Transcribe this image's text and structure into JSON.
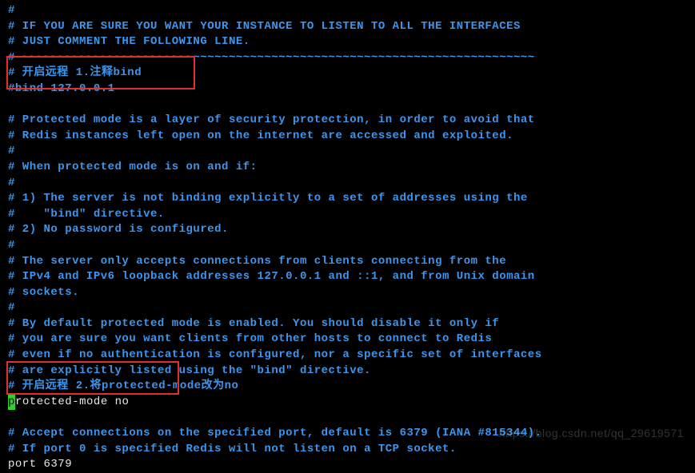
{
  "lines": [
    {
      "cls": "line",
      "text": "#"
    },
    {
      "cls": "line",
      "text": "# IF YOU ARE SURE YOU WANT YOUR INSTANCE TO LISTEN TO ALL THE INTERFACES"
    },
    {
      "cls": "line",
      "text": "# JUST COMMENT THE FOLLOWING LINE."
    },
    {
      "cls": "line",
      "text": "# ~~~~~~~~~~~~~~~~~~~~~~~~~~~~~~~~~~~~~~~~~~~~~~~~~~~~~~~~~~~~~~~~~~~~~~~~"
    },
    {
      "cls": "line",
      "text": "# 开启远程 1.注释bind"
    },
    {
      "cls": "line",
      "text": "#bind 127.0.0.1"
    },
    {
      "cls": "line",
      "text": ""
    },
    {
      "cls": "line",
      "text": "# Protected mode is a layer of security protection, in order to avoid that"
    },
    {
      "cls": "line",
      "text": "# Redis instances left open on the internet are accessed and exploited."
    },
    {
      "cls": "line",
      "text": "#"
    },
    {
      "cls": "line",
      "text": "# When protected mode is on and if:"
    },
    {
      "cls": "line",
      "text": "#"
    },
    {
      "cls": "line",
      "text": "# 1) The server is not binding explicitly to a set of addresses using the"
    },
    {
      "cls": "line",
      "text": "#    \"bind\" directive."
    },
    {
      "cls": "line",
      "text": "# 2) No password is configured."
    },
    {
      "cls": "line",
      "text": "#"
    },
    {
      "cls": "line",
      "text": "# The server only accepts connections from clients connecting from the"
    },
    {
      "cls": "line",
      "text": "# IPv4 and IPv6 loopback addresses 127.0.0.1 and ::1, and from Unix domain"
    },
    {
      "cls": "line",
      "text": "# sockets."
    },
    {
      "cls": "line",
      "text": "#"
    },
    {
      "cls": "line",
      "text": "# By default protected mode is enabled. You should disable it only if"
    },
    {
      "cls": "line",
      "text": "# you are sure you want clients from other hosts to connect to Redis"
    },
    {
      "cls": "line",
      "text": "# even if no authentication is configured, nor a specific set of interfaces"
    },
    {
      "cls": "line",
      "text": "# are explicitly listed using the \"bind\" directive."
    },
    {
      "cls": "line",
      "text": "# 开启远程 2.将protected-mode改为no"
    },
    {
      "cls": "white-line",
      "cursor": true,
      "text": "rotected-mode no"
    },
    {
      "cls": "line",
      "text": ""
    },
    {
      "cls": "line",
      "text": "# Accept connections on the specified port, default is 6379 (IANA #815344)."
    },
    {
      "cls": "line",
      "text": "# If port 0 is specified Redis will not listen on a TCP socket."
    },
    {
      "cls": "white-line",
      "text": "port 6379"
    }
  ],
  "watermark": "https://blog.csdn.net/qq_29619571"
}
